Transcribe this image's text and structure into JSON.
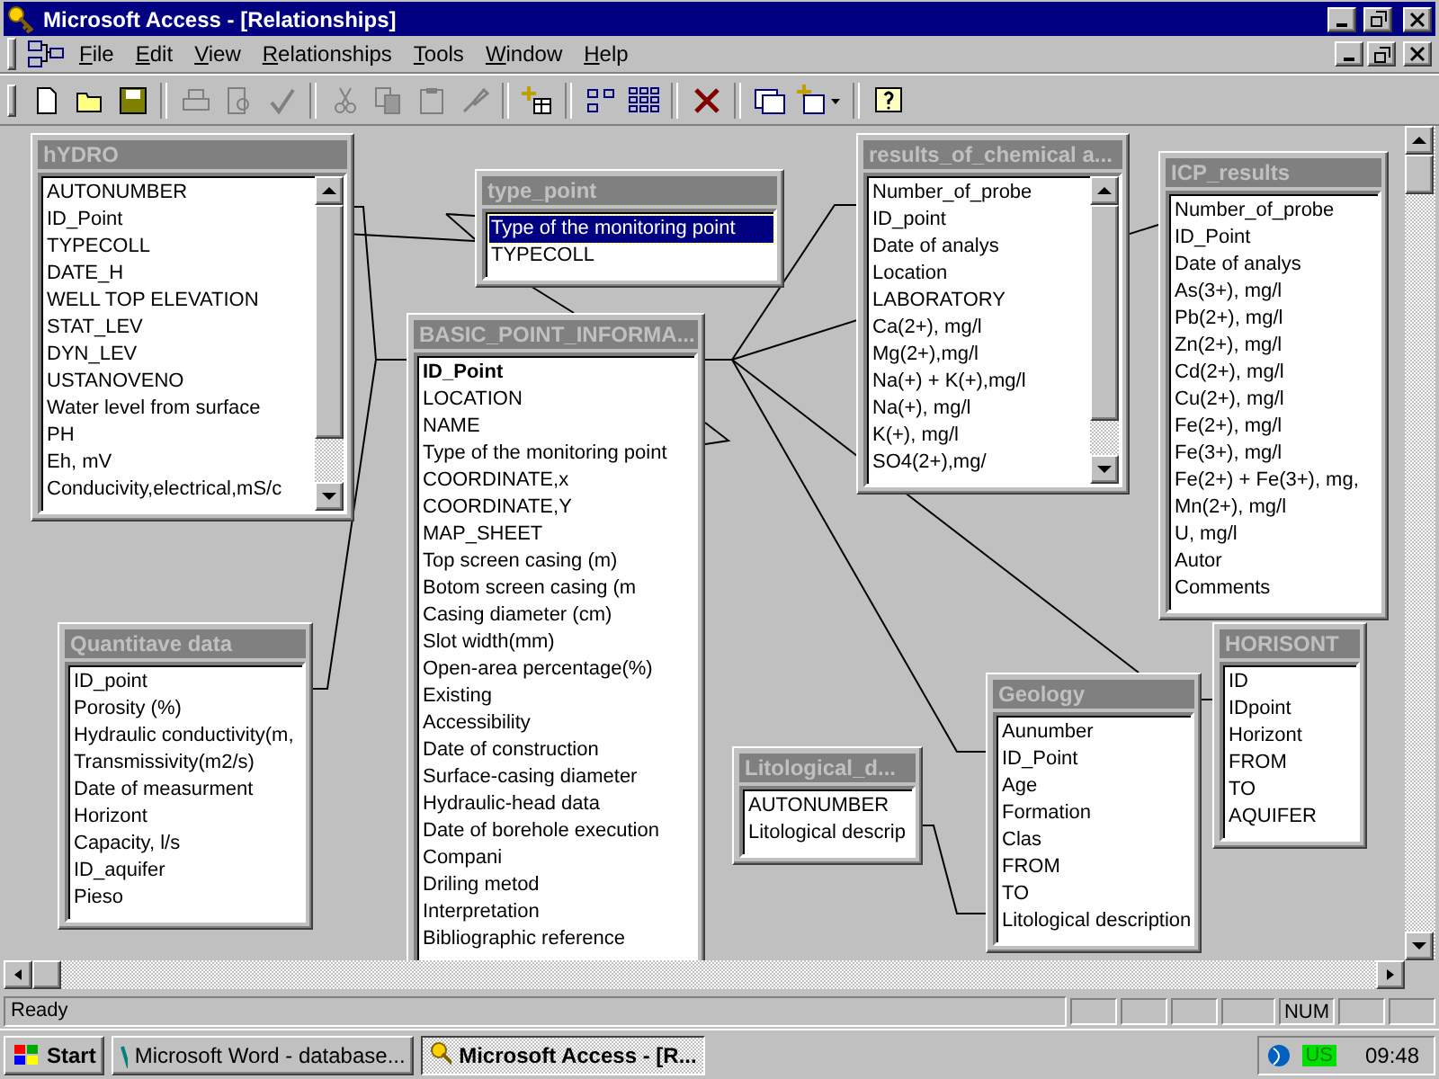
{
  "window": {
    "title": "Microsoft Access - [Relationships]"
  },
  "menu": [
    "File",
    "Edit",
    "View",
    "Relationships",
    "Tools",
    "Window",
    "Help"
  ],
  "toolbar": [
    {
      "disabled": false
    },
    {
      "disabled": false
    },
    {
      "disabled": false
    },
    {
      "disabled": true
    },
    {
      "disabled": true
    },
    {
      "disabled": true
    },
    {
      "disabled": true
    },
    {
      "disabled": true
    },
    {
      "disabled": true
    },
    {
      "disabled": true
    },
    {
      "disabled": false
    },
    {
      "disabled": false
    },
    {
      "disabled": false
    },
    {
      "disabled": false
    },
    {
      "disabled": false
    },
    {
      "disabled": false
    },
    {
      "disabled": false
    }
  ],
  "tables": [
    {
      "title": "hYDRO",
      "scrollable": true,
      "fields": [
        {
          "name": "AUTONUMBER",
          "selected": false,
          "primary_key": false
        },
        {
          "name": "ID_Point",
          "selected": false,
          "primary_key": false
        },
        {
          "name": "TYPECOLL",
          "selected": false,
          "primary_key": false
        },
        {
          "name": "DATE_H",
          "selected": false,
          "primary_key": false
        },
        {
          "name": "WELL TOP ELEVATION",
          "selected": false,
          "primary_key": false
        },
        {
          "name": "STAT_LEV",
          "selected": false,
          "primary_key": false
        },
        {
          "name": "DYN_LEV",
          "selected": false,
          "primary_key": false
        },
        {
          "name": "USTANOVENO",
          "selected": false,
          "primary_key": false
        },
        {
          "name": "Water level from surface",
          "selected": false,
          "primary_key": false
        },
        {
          "name": "PH",
          "selected": false,
          "primary_key": false
        },
        {
          "name": "Eh, mV",
          "selected": false,
          "primary_key": false
        },
        {
          "name": "Conducivity,electrical,mS/c",
          "selected": false,
          "primary_key": false
        }
      ]
    },
    {
      "title": "type_point",
      "scrollable": false,
      "fields": [
        {
          "name": "Type of the monitoring point",
          "selected": true,
          "primary_key": false
        },
        {
          "name": "TYPECOLL",
          "selected": false,
          "primary_key": false
        }
      ]
    },
    {
      "title": "BASIC_POINT_INFORMA...",
      "scrollable": false,
      "fields": [
        {
          "name": "ID_Point",
          "selected": false,
          "primary_key": true
        },
        {
          "name": "LOCATION",
          "selected": false,
          "primary_key": false
        },
        {
          "name": "NAME",
          "selected": false,
          "primary_key": false
        },
        {
          "name": "Type of the monitoring point",
          "selected": false,
          "primary_key": false
        },
        {
          "name": "COORDINATE,x",
          "selected": false,
          "primary_key": false
        },
        {
          "name": "COORDINATE,Y",
          "selected": false,
          "primary_key": false
        },
        {
          "name": "MAP_SHEET",
          "selected": false,
          "primary_key": false
        },
        {
          "name": "Top screen casing (m)",
          "selected": false,
          "primary_key": false
        },
        {
          "name": "Botom screen casing (m",
          "selected": false,
          "primary_key": false
        },
        {
          "name": "Casing diameter (cm)",
          "selected": false,
          "primary_key": false
        },
        {
          "name": "Slot width(mm)",
          "selected": false,
          "primary_key": false
        },
        {
          "name": "Open-area percentage(%)",
          "selected": false,
          "primary_key": false
        },
        {
          "name": "Existing",
          "selected": false,
          "primary_key": false
        },
        {
          "name": "Accessibility",
          "selected": false,
          "primary_key": false
        },
        {
          "name": "Date of construction",
          "selected": false,
          "primary_key": false
        },
        {
          "name": "Surface-casing diameter",
          "selected": false,
          "primary_key": false
        },
        {
          "name": "Hydraulic-head data",
          "selected": false,
          "primary_key": false
        },
        {
          "name": "Date of borehole execution",
          "selected": false,
          "primary_key": false
        },
        {
          "name": "Compani",
          "selected": false,
          "primary_key": false
        },
        {
          "name": "Driling metod",
          "selected": false,
          "primary_key": false
        },
        {
          "name": "Interpretation",
          "selected": false,
          "primary_key": false
        },
        {
          "name": "Bibliographic reference",
          "selected": false,
          "primary_key": false
        }
      ]
    },
    {
      "title": "results_of_chemical a...",
      "scrollable": true,
      "fields": [
        {
          "name": "Number_of_probe",
          "selected": false,
          "primary_key": false
        },
        {
          "name": "ID_point",
          "selected": false,
          "primary_key": false
        },
        {
          "name": "Date of analys",
          "selected": false,
          "primary_key": false
        },
        {
          "name": "Location",
          "selected": false,
          "primary_key": false
        },
        {
          "name": "LABORATORY",
          "selected": false,
          "primary_key": false
        },
        {
          "name": "Ca(2+), mg/l",
          "selected": false,
          "primary_key": false
        },
        {
          "name": "Mg(2+),mg/l",
          "selected": false,
          "primary_key": false
        },
        {
          "name": "Na(+) + K(+),mg/l",
          "selected": false,
          "primary_key": false
        },
        {
          "name": "Na(+), mg/l",
          "selected": false,
          "primary_key": false
        },
        {
          "name": "K(+), mg/l",
          "selected": false,
          "primary_key": false
        },
        {
          "name": "SO4(2+),mg/",
          "selected": false,
          "primary_key": false
        }
      ]
    },
    {
      "title": "ICP_results",
      "scrollable": false,
      "fields": [
        {
          "name": "Number_of_probe",
          "selected": false,
          "primary_key": false
        },
        {
          "name": "ID_Point",
          "selected": false,
          "primary_key": false
        },
        {
          "name": "Date of analys",
          "selected": false,
          "primary_key": false
        },
        {
          "name": "As(3+), mg/l",
          "selected": false,
          "primary_key": false
        },
        {
          "name": "Pb(2+), mg/l",
          "selected": false,
          "primary_key": false
        },
        {
          "name": "Zn(2+), mg/l",
          "selected": false,
          "primary_key": false
        },
        {
          "name": "Cd(2+), mg/l",
          "selected": false,
          "primary_key": false
        },
        {
          "name": "Cu(2+), mg/l",
          "selected": false,
          "primary_key": false
        },
        {
          "name": "Fe(2+), mg/l",
          "selected": false,
          "primary_key": false
        },
        {
          "name": "Fe(3+), mg/l",
          "selected": false,
          "primary_key": false
        },
        {
          "name": "Fe(2+) + Fe(3+), mg,",
          "selected": false,
          "primary_key": false
        },
        {
          "name": "Mn(2+), mg/l",
          "selected": false,
          "primary_key": false
        },
        {
          "name": "U, mg/l",
          "selected": false,
          "primary_key": false
        },
        {
          "name": "Autor",
          "selected": false,
          "primary_key": false
        },
        {
          "name": "Comments",
          "selected": false,
          "primary_key": false
        }
      ]
    },
    {
      "title": "Quantitave data",
      "scrollable": false,
      "fields": [
        {
          "name": "ID_point",
          "selected": false,
          "primary_key": false
        },
        {
          "name": "Porosity (%)",
          "selected": false,
          "primary_key": false
        },
        {
          "name": "Hydraulic conductivity(m,",
          "selected": false,
          "primary_key": false
        },
        {
          "name": "Transmissivity(m2/s)",
          "selected": false,
          "primary_key": false
        },
        {
          "name": "Date of measurment",
          "selected": false,
          "primary_key": false
        },
        {
          "name": "Horizont",
          "selected": false,
          "primary_key": false
        },
        {
          "name": "Capacity, l/s",
          "selected": false,
          "primary_key": false
        },
        {
          "name": "ID_aquifer",
          "selected": false,
          "primary_key": false
        },
        {
          "name": "Pieso",
          "selected": false,
          "primary_key": false
        }
      ]
    },
    {
      "title": "HORISONT",
      "scrollable": false,
      "fields": [
        {
          "name": "ID",
          "selected": false,
          "primary_key": false
        },
        {
          "name": "IDpoint",
          "selected": false,
          "primary_key": false
        },
        {
          "name": "Horizont",
          "selected": false,
          "primary_key": false
        },
        {
          "name": "FROM",
          "selected": false,
          "primary_key": false
        },
        {
          "name": "TO",
          "selected": false,
          "primary_key": false
        },
        {
          "name": "AQUIFER",
          "selected": false,
          "primary_key": false
        }
      ]
    },
    {
      "title": "Litological_d...",
      "scrollable": false,
      "fields": [
        {
          "name": "AUTONUMBER",
          "selected": false,
          "primary_key": false
        },
        {
          "name": "Litological descrip",
          "selected": false,
          "primary_key": false
        }
      ]
    },
    {
      "title": "Geology",
      "scrollable": false,
      "fields": [
        {
          "name": "Aunumber",
          "selected": false,
          "primary_key": false
        },
        {
          "name": "ID_Point",
          "selected": false,
          "primary_key": false
        },
        {
          "name": "Age",
          "selected": false,
          "primary_key": false
        },
        {
          "name": "Formation",
          "selected": false,
          "primary_key": false
        },
        {
          "name": "Clas",
          "selected": false,
          "primary_key": false
        },
        {
          "name": "FROM",
          "selected": false,
          "primary_key": false
        },
        {
          "name": "TO",
          "selected": false,
          "primary_key": false
        },
        {
          "name": "Litological description",
          "selected": false,
          "primary_key": false
        }
      ]
    }
  ],
  "status_bar": {
    "text": "Ready",
    "num_indicator": "NUM"
  },
  "taskbar": {
    "start": "Start",
    "tasks": [
      {
        "label": "Microsoft Word - database...",
        "selected": false
      },
      {
        "label": "Microsoft Access - [R...",
        "selected": true
      }
    ],
    "language": "US",
    "clock": "09:48"
  }
}
